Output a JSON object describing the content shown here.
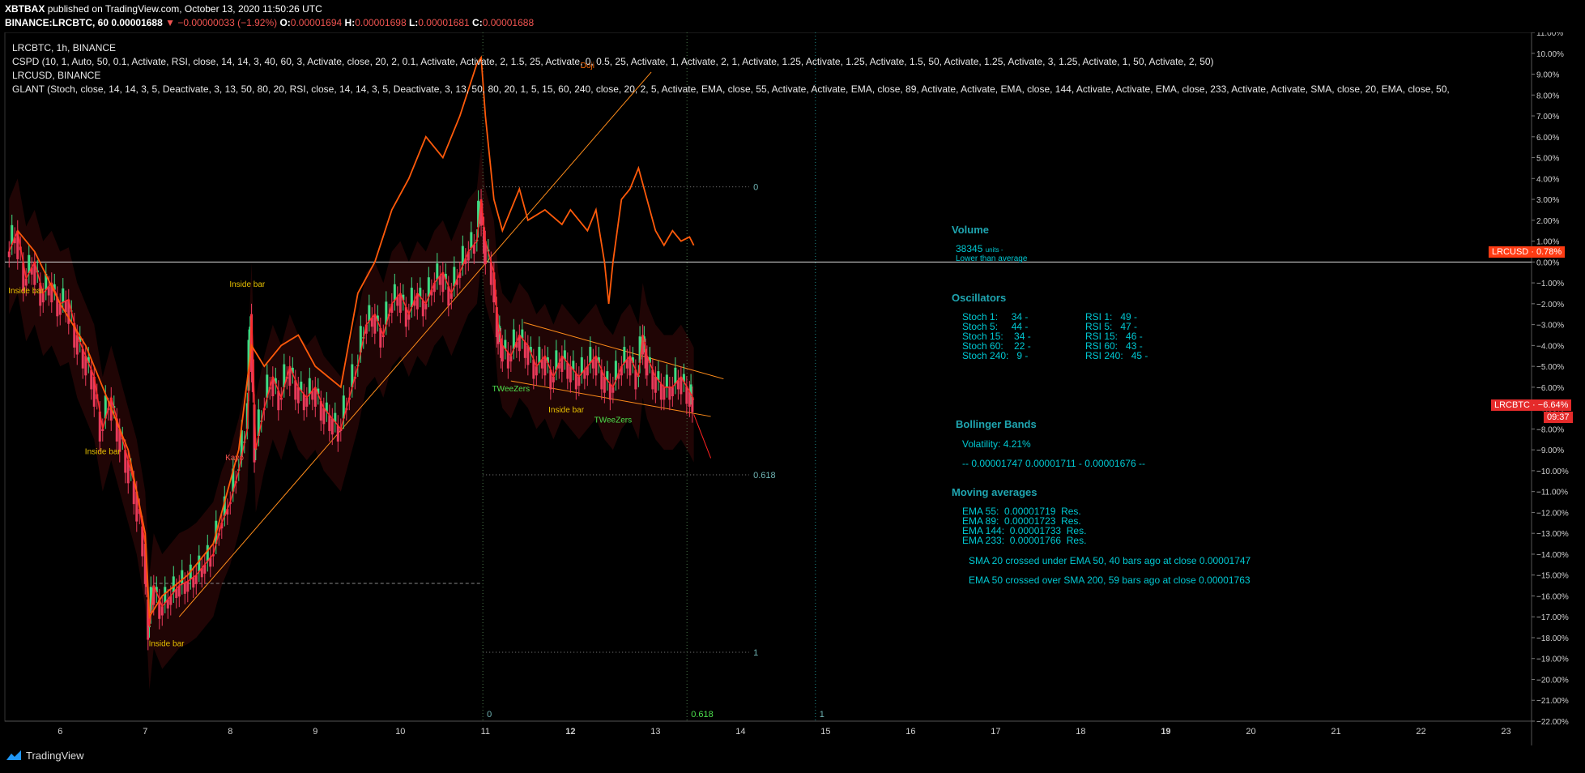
{
  "header": {
    "author": "XBTBAX",
    "published": "published on TradingView.com, October 13, 2020 11:50:26 UTC",
    "symbol": "BINANCE:LRCBTC, 60",
    "price": "0.00001688",
    "change_arrow": "▼",
    "change": "−0.00000033 (−1.92%)",
    "o_label": "O:",
    "o": "0.00001694",
    "h_label": "H:",
    "h": "0.00001698",
    "l_label": "L:",
    "l": "0.00001681",
    "c_label": "C:",
    "c": "0.00001688"
  },
  "legend": {
    "main": "LRCBTC, 1h, BINANCE",
    "cspd": "CSPD (10, 1, Auto, 50, 0.1, Activate, RSI, close, 14, 14, 3, 40, 60, 3, Activate, close, 20, 2, 0.1, Activate, Activate, 2, 1.5, 25, Activate, 0, 0.5, 25, Activate, 1, Activate, 2, 1, Activate, 1.25, Activate, 1.25, Activate, 1.5, 50, Activate, 1.25, Activate, 3, 1.25, Activate, 1, 50, Activate, 2, 50)",
    "lrcusd": "LRCUSD, BINANCE",
    "glant": "GLANT (Stoch, close, 14, 14, 3, 5, Deactivate, 3, 13, 50, 80, 20, RSI, close, 14, 14, 3, 5, Deactivate, 3, 13, 50, 80, 20, 1, 5, 15, 60, 240, close, 20, 2, 5, Activate, EMA, close, 55, Activate, Activate, EMA, close, 89, Activate, Activate, EMA, close, 144, Activate, Activate, EMA, close, 233, Activate, Activate, SMA, close, 20, EMA, close, 50,"
  },
  "panel": {
    "volume_title": "Volume",
    "volume_value": "38345",
    "volume_unit": "units -",
    "volume_note": "Lower than average",
    "osc_title": "Oscillators",
    "stoch": [
      {
        "label": "Stoch 1:",
        "value": "34 -"
      },
      {
        "label": "Stoch 5:",
        "value": "44 -"
      },
      {
        "label": "Stoch 15:",
        "value": "34 -"
      },
      {
        "label": "Stoch 60:",
        "value": "22 -"
      },
      {
        "label": "Stoch 240:",
        "value": "9 -"
      }
    ],
    "rsi": [
      {
        "label": "RSI 1:",
        "value": "49 -"
      },
      {
        "label": "RSI 5:",
        "value": "47 -"
      },
      {
        "label": "RSI 15:",
        "value": "46 -"
      },
      {
        "label": "RSI 60:",
        "value": "43 -"
      },
      {
        "label": "RSI 240:",
        "value": "45 -"
      }
    ],
    "bb_title": "Bollinger Bands",
    "bb_volatility": "Volatility:  4.21%",
    "bb_levels": "-- 0.00001747   0.00001711 -   0.00001676 --",
    "ma_title": "Moving averages",
    "ema": [
      {
        "label": "EMA 55:",
        "value": "0.00001719",
        "res": "Res."
      },
      {
        "label": "EMA 89:",
        "value": "0.00001723",
        "res": "Res."
      },
      {
        "label": "EMA 144:",
        "value": "0.00001733",
        "res": "Res."
      },
      {
        "label": "EMA 233:",
        "value": "0.00001766",
        "res": "Res."
      }
    ],
    "cross1": "SMA 20 crossed under EMA 50, 40 bars ago at close 0.00001747",
    "cross2": "EMA 50 crossed over SMA 200, 59 bars ago at close 0.00001763"
  },
  "tags": {
    "lrcusd": "LRCUSD · 0.78%",
    "lrcbtc": "LRCBTC · −6.64%",
    "countdown": "09:37"
  },
  "footer": {
    "brand": "TradingView"
  },
  "chart_data": {
    "type": "candlestick",
    "yaxis": {
      "unit": "percent",
      "ticks": [
        "11.00%",
        "10.00%",
        "9.00%",
        "8.00%",
        "7.00%",
        "6.00%",
        "5.00%",
        "4.00%",
        "3.00%",
        "2.00%",
        "1.00%",
        "0.00%",
        "−1.00%",
        "−2.00%",
        "−3.00%",
        "−4.00%",
        "−5.00%",
        "−6.00%",
        "−7.00%",
        "−8.00%",
        "−9.00%",
        "−10.00%",
        "−11.00%",
        "−12.00%",
        "−13.00%",
        "−14.00%",
        "−15.00%",
        "−16.00%",
        "−17.00%",
        "−18.00%",
        "−19.00%",
        "−20.00%",
        "−21.00%",
        "−22.00%"
      ],
      "range": [
        -22,
        11
      ]
    },
    "xaxis": {
      "ticks": [
        {
          "label": "6",
          "day": 6
        },
        {
          "label": "7",
          "day": 7
        },
        {
          "label": "8",
          "day": 8
        },
        {
          "label": "9",
          "day": 9
        },
        {
          "label": "10",
          "day": 10
        },
        {
          "label": "11",
          "day": 11
        },
        {
          "label": "12",
          "day": 12,
          "bold": true
        },
        {
          "label": "13",
          "day": 13
        },
        {
          "label": "14",
          "day": 14
        },
        {
          "label": "15",
          "day": 15
        },
        {
          "label": "16",
          "day": 16
        },
        {
          "label": "17",
          "day": 17
        },
        {
          "label": "18",
          "day": 18
        },
        {
          "label": "19",
          "day": 19,
          "bold": true
        },
        {
          "label": "20",
          "day": 20
        },
        {
          "label": "21",
          "day": 21
        },
        {
          "label": "22",
          "day": 22
        },
        {
          "label": "23",
          "day": 23
        }
      ],
      "range": [
        5.35,
        23.3
      ]
    },
    "lrcbtc_path": [
      [
        5.4,
        0.5
      ],
      [
        5.5,
        1.5
      ],
      [
        5.6,
        -0.8
      ],
      [
        5.7,
        0
      ],
      [
        5.8,
        -1.5
      ],
      [
        5.9,
        -1
      ],
      [
        6.0,
        -2
      ],
      [
        6.1,
        -1.8
      ],
      [
        6.2,
        -3.5
      ],
      [
        6.3,
        -4.5
      ],
      [
        6.4,
        -5.5
      ],
      [
        6.5,
        -8
      ],
      [
        6.6,
        -6.5
      ],
      [
        6.7,
        -8
      ],
      [
        6.8,
        -9.5
      ],
      [
        6.9,
        -11
      ],
      [
        7.0,
        -13.5
      ],
      [
        7.05,
        -17.5
      ],
      [
        7.1,
        -15.5
      ],
      [
        7.2,
        -16.5
      ],
      [
        7.3,
        -16
      ],
      [
        7.4,
        -15.5
      ],
      [
        7.5,
        -15.3
      ],
      [
        7.6,
        -15
      ],
      [
        7.7,
        -14.5
      ],
      [
        7.8,
        -14
      ],
      [
        7.9,
        -12.5
      ],
      [
        8.0,
        -11.5
      ],
      [
        8.1,
        -10
      ],
      [
        8.2,
        -8
      ],
      [
        8.25,
        -2.5
      ],
      [
        8.3,
        -9
      ],
      [
        8.4,
        -7
      ],
      [
        8.5,
        -5.5
      ],
      [
        8.6,
        -6.5
      ],
      [
        8.7,
        -5
      ],
      [
        8.8,
        -6
      ],
      [
        8.9,
        -6.5
      ],
      [
        9.0,
        -6
      ],
      [
        9.1,
        -7
      ],
      [
        9.2,
        -7.5
      ],
      [
        9.3,
        -8
      ],
      [
        9.4,
        -6.5
      ],
      [
        9.5,
        -5
      ],
      [
        9.6,
        -3
      ],
      [
        9.7,
        -2.5
      ],
      [
        9.8,
        -3.5
      ],
      [
        9.9,
        -2
      ],
      [
        10.0,
        -1.5
      ],
      [
        10.1,
        -2.5
      ],
      [
        10.2,
        -1.5
      ],
      [
        10.3,
        -2
      ],
      [
        10.4,
        -1
      ],
      [
        10.5,
        -0.5
      ],
      [
        10.6,
        -1.5
      ],
      [
        10.7,
        -0.5
      ],
      [
        10.8,
        0.5
      ],
      [
        10.9,
        1
      ],
      [
        10.95,
        3
      ],
      [
        11.0,
        1
      ],
      [
        11.1,
        -0.5
      ],
      [
        11.15,
        -3
      ],
      [
        11.2,
        -4
      ],
      [
        11.3,
        -4.5
      ],
      [
        11.4,
        -3.5
      ],
      [
        11.5,
        -4
      ],
      [
        11.6,
        -5
      ],
      [
        11.7,
        -4.5
      ],
      [
        11.8,
        -5.5
      ],
      [
        11.9,
        -4.5
      ],
      [
        12.0,
        -5
      ],
      [
        12.1,
        -5.5
      ],
      [
        12.2,
        -5
      ],
      [
        12.3,
        -4.5
      ],
      [
        12.4,
        -5.5
      ],
      [
        12.5,
        -6
      ],
      [
        12.6,
        -5
      ],
      [
        12.7,
        -4.5
      ],
      [
        12.8,
        -5.5
      ],
      [
        12.85,
        -3.5
      ],
      [
        12.9,
        -4.5
      ],
      [
        13.0,
        -5.5
      ],
      [
        13.1,
        -6
      ],
      [
        13.2,
        -6
      ],
      [
        13.3,
        -5.5
      ],
      [
        13.4,
        -6.2
      ],
      [
        13.45,
        -6.6
      ]
    ],
    "lrcusd_path": [
      [
        5.5,
        1.5
      ],
      [
        5.7,
        0.5
      ],
      [
        6.0,
        -2
      ],
      [
        6.3,
        -4
      ],
      [
        6.5,
        -6
      ],
      [
        6.8,
        -9
      ],
      [
        7.0,
        -13
      ],
      [
        7.05,
        -17
      ],
      [
        7.2,
        -16
      ],
      [
        7.5,
        -15
      ],
      [
        7.8,
        -13.5
      ],
      [
        8.1,
        -9
      ],
      [
        8.25,
        -4
      ],
      [
        8.4,
        -5
      ],
      [
        8.6,
        -4
      ],
      [
        8.8,
        -3.5
      ],
      [
        9.0,
        -5
      ],
      [
        9.3,
        -6
      ],
      [
        9.5,
        -1.5
      ],
      [
        9.7,
        0
      ],
      [
        9.9,
        2.5
      ],
      [
        10.1,
        4
      ],
      [
        10.3,
        6
      ],
      [
        10.5,
        5
      ],
      [
        10.7,
        7
      ],
      [
        10.9,
        9.5
      ],
      [
        10.95,
        9.8
      ],
      [
        11.0,
        7
      ],
      [
        11.1,
        3
      ],
      [
        11.2,
        1.5
      ],
      [
        11.3,
        2.5
      ],
      [
        11.4,
        3.5
      ],
      [
        11.5,
        2
      ],
      [
        11.7,
        2.5
      ],
      [
        11.9,
        1.8
      ],
      [
        12.0,
        2.5
      ],
      [
        12.2,
        1.5
      ],
      [
        12.3,
        2.5
      ],
      [
        12.4,
        0
      ],
      [
        12.45,
        -2
      ],
      [
        12.5,
        0
      ],
      [
        12.6,
        3
      ],
      [
        12.7,
        3.5
      ],
      [
        12.8,
        4.5
      ],
      [
        12.9,
        3
      ],
      [
        13.0,
        1.5
      ],
      [
        13.1,
        0.8
      ],
      [
        13.2,
        1.5
      ],
      [
        13.3,
        1
      ],
      [
        13.4,
        1.2
      ],
      [
        13.45,
        0.8
      ]
    ],
    "fib_levels": [
      {
        "label": "0",
        "value": 3.6
      },
      {
        "label": "0.618",
        "value": -10.2
      },
      {
        "label": "1",
        "value": -18.7
      }
    ],
    "fib_time": [
      {
        "label": "0",
        "day": 10.97
      },
      {
        "label": "0.618",
        "day": 13.37
      },
      {
        "label": "1",
        "day": 14.88
      }
    ],
    "annotations": [
      {
        "text": "Inside bar",
        "day": 5.6,
        "value": -1.5,
        "color": "#e8c000"
      },
      {
        "text": "Inside bar",
        "day": 8.2,
        "value": -1.2,
        "color": "#e8c000"
      },
      {
        "text": "Inside bar",
        "day": 6.5,
        "value": -9.2,
        "color": "#e8c000"
      },
      {
        "text": "Inside bar",
        "day": 7.25,
        "value": -18.4,
        "color": "#e8c000"
      },
      {
        "text": "Kayo",
        "day": 8.05,
        "value": -9.5,
        "color": "#ef5350"
      },
      {
        "text": "Doji",
        "day": 12.2,
        "value": 9.3,
        "color": "#ff6a00"
      },
      {
        "text": "TWeeZers",
        "day": 11.3,
        "value": -6.2,
        "color": "#4ce04c"
      },
      {
        "text": "Inside bar",
        "day": 11.95,
        "value": -7.2,
        "color": "#e8c000"
      },
      {
        "text": "TWeeZers",
        "day": 12.5,
        "value": -7.7,
        "color": "#4ce04c"
      }
    ]
  }
}
